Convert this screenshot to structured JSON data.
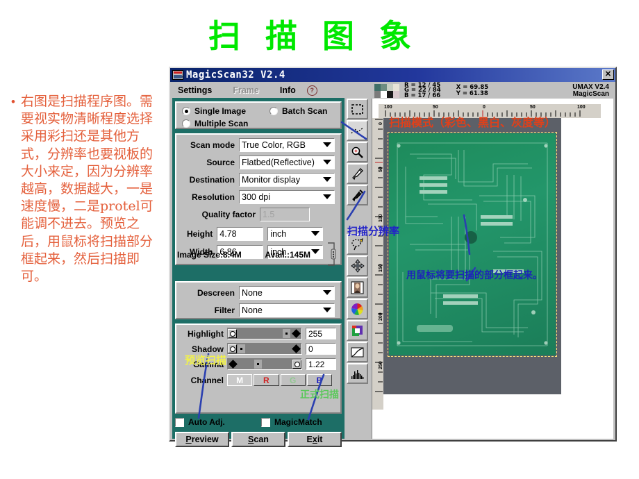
{
  "slide": {
    "title": "扫 描 图 象",
    "title_color": "#00e800",
    "bullet_dot": "•",
    "bullet_text": "右图是扫描程序图。需要视实物清晰程度选择采用彩扫还是其他方式，分辨率也要视板的大小来定，因为分辨率越高，数据越大，一是速度慢，二是protel可能调不进去。预览之后，用鼠标将扫描部分框起来，然后扫描即可。",
    "bullet_color": "#e4603c"
  },
  "annotations": {
    "scan_mode": "扫描模式（彩色、黑白、灰度等）",
    "scan_mode_color": "#e0401a",
    "resolution": "扫描分辨率",
    "resolution_color": "#2222c8",
    "mouse_hint": "用鼠标将要扫描的部分框起来。",
    "mouse_hint_color": "#1d25b8",
    "preview_scan": "预览扫描",
    "preview_scan_color": "#f2f24a",
    "formal_scan": "正式扫描",
    "formal_scan_color": "#5ac85a"
  },
  "window": {
    "title": "MagicScan32 V2.4",
    "close_label": "✕",
    "icon": "scanner-icon"
  },
  "menu": {
    "items": [
      {
        "label": "Settings",
        "disabled": false
      },
      {
        "label": "Frame",
        "disabled": true
      },
      {
        "label": "Info",
        "disabled": false
      }
    ],
    "help_icon_label": "?"
  },
  "scan_type": {
    "options": [
      {
        "label": "Single Image",
        "selected": true
      },
      {
        "label": "Batch Scan",
        "selected": false
      },
      {
        "label": "Multiple Scan",
        "selected": false
      }
    ]
  },
  "settings": {
    "scan_mode": {
      "label": "Scan mode",
      "value": "True Color, RGB"
    },
    "source": {
      "label": "Source",
      "value": "Flatbed(Reflective)"
    },
    "destination": {
      "label": "Destination",
      "value": "Monitor display"
    },
    "resolution": {
      "label": "Resolution",
      "value": "300 dpi"
    },
    "quality_factor": {
      "label": "Quality factor",
      "value": "1.5",
      "disabled": true
    },
    "height": {
      "label": "Height",
      "value": "4.78",
      "unit": "inch"
    },
    "width": {
      "label": "Width",
      "value": "6.86",
      "unit": "inch"
    },
    "image_size": "Image Size:8.4M",
    "avail": "Avail.:145M"
  },
  "filters": {
    "descreen": {
      "label": "Descreen",
      "value": "None"
    },
    "filter": {
      "label": "Filter",
      "value": "None"
    }
  },
  "tone": {
    "highlight": {
      "label": "Highlight",
      "value": "255"
    },
    "shadow": {
      "label": "Shadow",
      "value": "0"
    },
    "gamma": {
      "label": "Gamma",
      "value": "1.22"
    },
    "channel": {
      "label": "Channel",
      "buttons": [
        {
          "label": "M",
          "color": "#ffffff",
          "selected": true
        },
        {
          "label": "R",
          "color": "#d02020",
          "selected": false
        },
        {
          "label": "G",
          "color": "#90c890",
          "selected": false
        },
        {
          "label": "B",
          "color": "#2020c0",
          "selected": false
        }
      ]
    }
  },
  "checkboxes": [
    {
      "label": "Auto Adj.",
      "checked": false
    },
    {
      "label": "MagicMatch",
      "checked": false
    }
  ],
  "buttons": [
    {
      "label": "Preview",
      "accel": "P"
    },
    {
      "label": "Scan",
      "accel": "S"
    },
    {
      "label": "Exit",
      "accel": "x"
    }
  ],
  "toolbar": {
    "icons": [
      "marquee-select-icon",
      "marquee-dashed-icon",
      "zoom-icon",
      "eyedropper-white-icon",
      "eyedropper-black-icon",
      "lasso-icon",
      "move-icon",
      "photo-icon",
      "color-wheel-icon",
      "color-balance-icon",
      "curves-icon",
      "histogram-icon"
    ]
  },
  "status": {
    "rgb": "R = 12 / 45\nG = 22 / 84\nB = 17 / 66",
    "xy": "X = 69.85\nY = 61.38",
    "brand": "UMAX",
    "brand_version": "V2.4",
    "brand_product": "MagicScan"
  },
  "rulers": {
    "horizontal": [
      "100",
      "50",
      "0",
      "50",
      "100"
    ],
    "vertical": [
      "0",
      "50",
      "100",
      "150",
      "200",
      "250"
    ]
  }
}
